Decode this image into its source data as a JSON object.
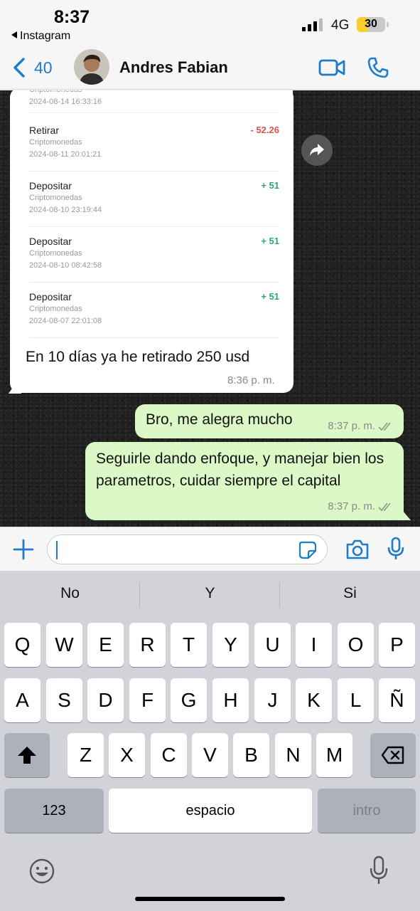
{
  "status_bar": {
    "time": "8:37",
    "back_app": "Instagram",
    "network": "4G",
    "battery": "30",
    "battery_color": "#f7ce2e"
  },
  "header": {
    "back_count": "40",
    "contact_name": "Andres Fabian",
    "accent_color": "#1e7cc8",
    "icons": [
      "chevron-left-icon",
      "video-call-icon",
      "phone-icon"
    ]
  },
  "chat": {
    "screenshot_transactions": [
      {
        "title": "",
        "subtitle": "Criptomonedas",
        "date": "2024-08-14 16:33:16",
        "amount": "",
        "amount_color": "#d9534f"
      },
      {
        "title": "Retirar",
        "subtitle": "Criptomonedas",
        "date": "2024-08-11 20:01:21",
        "amount": "- 52.26",
        "amount_color": "#d9534f"
      },
      {
        "title": "Depositar",
        "subtitle": "Criptomonedas",
        "date": "2024-08-10 23:19:44",
        "amount": "+ 51",
        "amount_color": "#2fa37a"
      },
      {
        "title": "Depositar",
        "subtitle": "Criptomonedas",
        "date": "2024-08-10 08:42:58",
        "amount": "+ 51",
        "amount_color": "#2fa37a"
      },
      {
        "title": "Depositar",
        "subtitle": "Criptomonedas",
        "date": "2024-08-07 22:01:08",
        "amount": "+ 51",
        "amount_color": "#2fa37a"
      }
    ],
    "incoming": {
      "caption": "En 10 días ya he retirado 250 usd",
      "time": "8:36 p. m."
    },
    "outgoing": [
      {
        "text": "Bro, me alegra mucho",
        "time": "8:37 p. m."
      },
      {
        "text": "Seguirle dando enfoque, y manejar bien los parametros, cuidar siempre el capital",
        "time": "8:37 p. m."
      }
    ]
  },
  "input_bar": {
    "placeholder": "",
    "icons": [
      "plus-icon",
      "sticker-icon",
      "camera-icon",
      "microphone-icon"
    ]
  },
  "keyboard": {
    "suggestions": [
      "No",
      "Y",
      "Si"
    ],
    "row1": [
      "Q",
      "W",
      "E",
      "R",
      "T",
      "Y",
      "U",
      "I",
      "O",
      "P"
    ],
    "row2": [
      "A",
      "S",
      "D",
      "F",
      "G",
      "H",
      "J",
      "K",
      "L",
      "Ñ"
    ],
    "row3": [
      "Z",
      "X",
      "C",
      "V",
      "B",
      "N",
      "M"
    ],
    "numbers_key": "123",
    "space_key": "espacio",
    "return_key": "intro"
  }
}
